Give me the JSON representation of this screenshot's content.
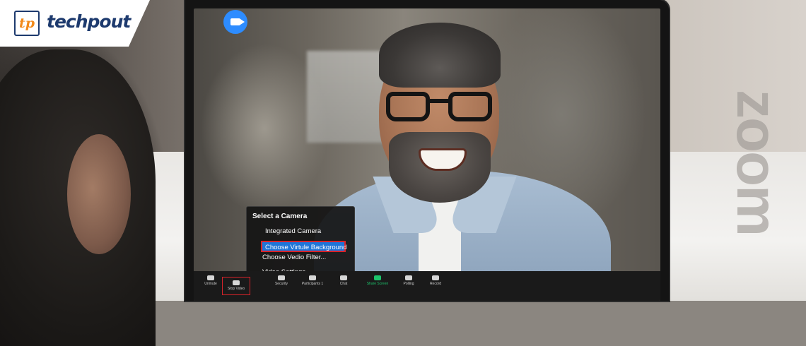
{
  "logo": {
    "mark": "tp",
    "text": "techpout"
  },
  "watermark": {
    "text": "zoom"
  },
  "video_icon": "video-camera-icon",
  "camera_menu": {
    "title": "Select a Camera",
    "items": [
      {
        "label": "Integrated Camera"
      },
      {
        "label": "Choose Virtule Background",
        "selected": true
      },
      {
        "label": "Choose Vedio Filter..."
      },
      {
        "label": "Video Settings..."
      }
    ]
  },
  "toolbar": {
    "buttons": [
      {
        "label": "Unmute",
        "icon": "microphone-icon"
      },
      {
        "label": "Stop Video",
        "icon": "video-camera-icon"
      },
      {
        "label": "Security",
        "icon": "shield-icon"
      },
      {
        "label": "Participants",
        "icon": "participants-icon",
        "count": "1"
      },
      {
        "label": "Chat",
        "icon": "chat-icon"
      },
      {
        "label": "Share Screen",
        "icon": "share-screen-icon"
      },
      {
        "label": "Polling",
        "icon": "bar-chart-icon"
      },
      {
        "label": "Record",
        "icon": "record-icon"
      }
    ]
  },
  "colors": {
    "zoom_blue": "#2d8cff",
    "highlight_red": "#d8232a",
    "menu_selected": "#1e74d8",
    "share_green": "#1cc36b",
    "brand_navy": "#1d3a6e",
    "brand_orange": "#f28a1a"
  }
}
